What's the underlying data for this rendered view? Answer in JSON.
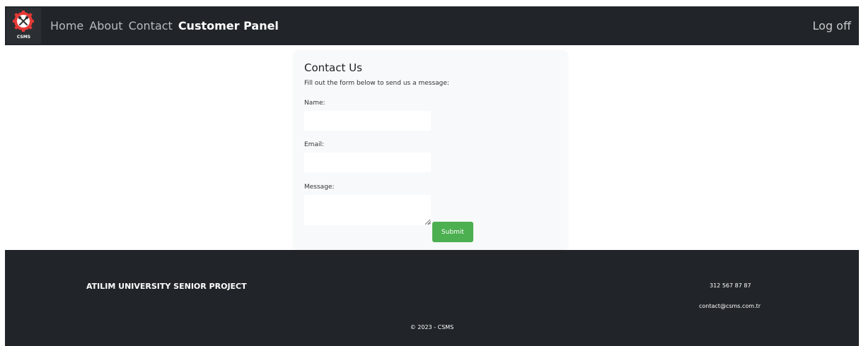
{
  "brand": {
    "logo_text": "CSMS",
    "accent_color": "#e53935"
  },
  "nav": {
    "items": [
      {
        "label": "Home",
        "active": false
      },
      {
        "label": "About",
        "active": false
      },
      {
        "label": "Contact",
        "active": false
      },
      {
        "label": "Customer Panel",
        "active": true
      }
    ],
    "logoff_label": "Log off"
  },
  "contact": {
    "title": "Contact Us",
    "intro": "Fill out the form below to send us a message:",
    "name_label": "Name:",
    "name_value": "",
    "email_label": "Email:",
    "email_value": "",
    "message_label": "Message:",
    "message_value": "",
    "submit_label": "Submit",
    "submit_color": "#4caf50"
  },
  "footer": {
    "project": "ATILIM UNIVERSITY SENIOR PROJECT",
    "phone": "312 567 87 87",
    "email": "contact@csms.com.tr",
    "copyright": "© 2023 - CSMS"
  }
}
